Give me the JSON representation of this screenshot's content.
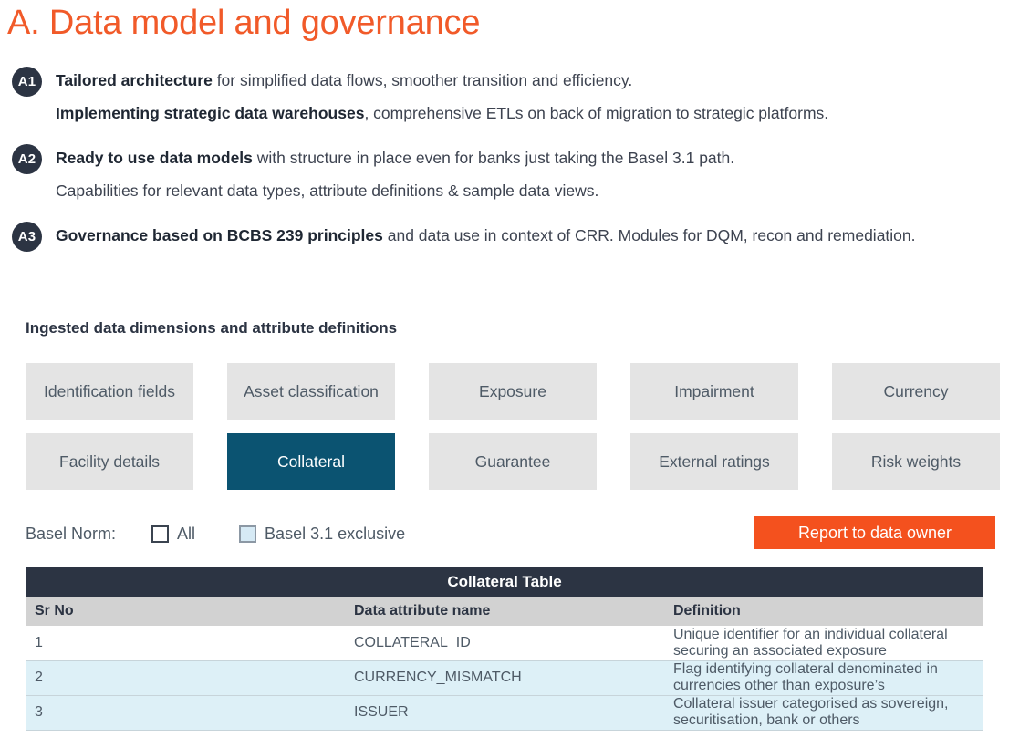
{
  "title": "A. Data model and governance",
  "colors": {
    "title_orange": "#f15a29",
    "badge_navy": "#2c3443",
    "tile_gray": "#e4e4e4",
    "tile_selected_teal": "#0b5371",
    "button_orange": "#f4511e",
    "row_alt_blue": "#ddf0f7"
  },
  "bullets": [
    {
      "badge": "A1",
      "lines": [
        {
          "bold": "Tailored architecture",
          "rest": " for simplified data flows, smoother transition and efficiency."
        },
        {
          "bold": "Implementing strategic data warehouses",
          "rest": ", comprehensive ETLs on back of migration to strategic platforms."
        }
      ]
    },
    {
      "badge": "A2",
      "lines": [
        {
          "bold": "Ready to use data models",
          "rest": " with structure in place even for banks just taking the Basel 3.1 path."
        },
        {
          "bold": "",
          "rest": "Capabilities for relevant data types, attribute definitions & sample data views."
        }
      ]
    },
    {
      "badge": "A3",
      "lines": [
        {
          "bold": "Governance based on BCBS 239 principles",
          "rest": " and data use in context of CRR. Modules for DQM, recon and remediation."
        }
      ]
    }
  ],
  "section_heading": "Ingested data dimensions and attribute definitions",
  "tiles": [
    {
      "label": "Identification fields",
      "selected": false
    },
    {
      "label": "Asset classification",
      "selected": false
    },
    {
      "label": "Exposure",
      "selected": false
    },
    {
      "label": "Impairment",
      "selected": false
    },
    {
      "label": "Currency",
      "selected": false
    },
    {
      "label": "Facility details",
      "selected": false
    },
    {
      "label": "Collateral",
      "selected": true
    },
    {
      "label": "Guarantee",
      "selected": false
    },
    {
      "label": "External ratings",
      "selected": false
    },
    {
      "label": "Risk weights",
      "selected": false
    }
  ],
  "filter": {
    "label": "Basel Norm:",
    "options": [
      {
        "label": "All",
        "checked": false,
        "filled": false
      },
      {
        "label": "Basel 3.1 exclusive",
        "checked": false,
        "filled": true
      }
    ]
  },
  "report_button": "Report to data owner",
  "table": {
    "title": "Collateral Table",
    "columns": [
      "Sr No",
      "Data attribute name",
      "Definition"
    ],
    "rows": [
      {
        "sr": "1",
        "attr": "COLLATERAL_ID",
        "def": "Unique identifier for an individual collateral securing an associated exposure"
      },
      {
        "sr": "2",
        "attr": "CURRENCY_MISMATCH",
        "def": "Flag identifying collateral denominated in currencies other than exposure’s"
      },
      {
        "sr": "3",
        "attr": "ISSUER",
        "def": "Collateral issuer categorised as sovereign, securitisation, bank or others"
      }
    ]
  }
}
